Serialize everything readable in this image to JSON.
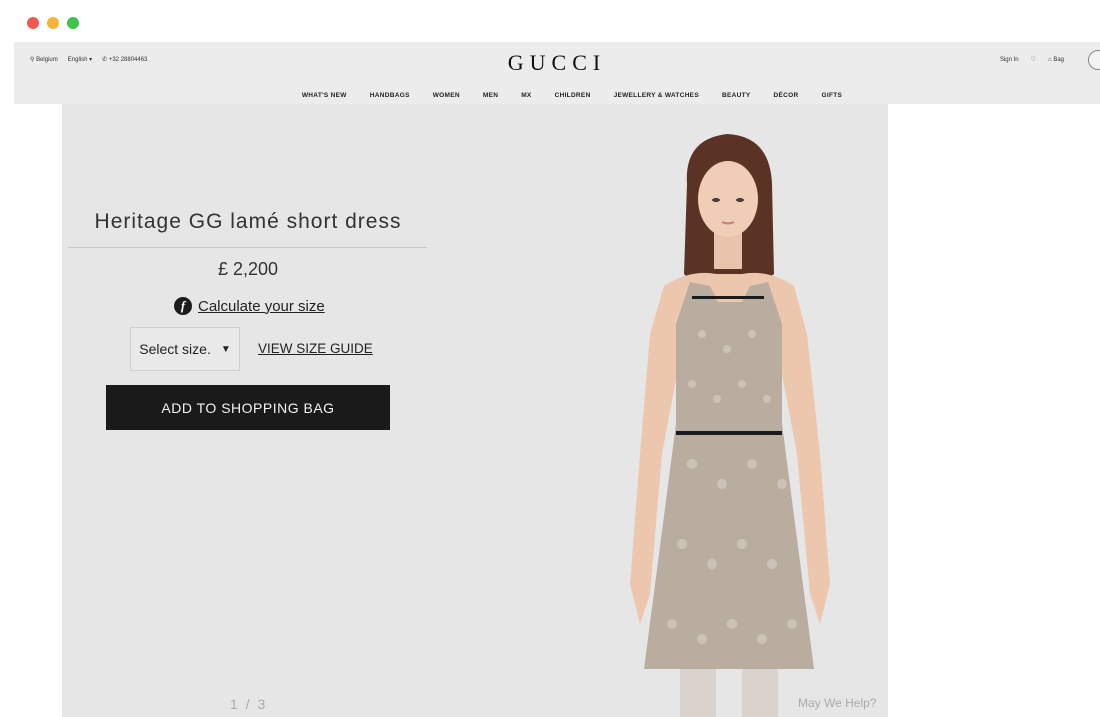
{
  "header": {
    "location": "Belgium",
    "language": "English",
    "phone": "+32 28804463",
    "logo": "GUCCI",
    "sign_in": "Sign In",
    "bag": "Bag"
  },
  "nav": [
    "WHAT'S NEW",
    "HANDBAGS",
    "WOMEN",
    "MEN",
    "MX",
    "CHILDREN",
    "JEWELLERY & WATCHES",
    "BEAUTY",
    "DÉCOR",
    "GIFTS"
  ],
  "product": {
    "title": "Heritage GG lamé short dress",
    "price": "£ 2,200",
    "calculate_size": "Calculate your size",
    "select_size": "Select size.",
    "size_guide": "VIEW SIZE GUIDE",
    "add_to_bag": "ADD TO SHOPPING BAG"
  },
  "gallery": {
    "pager": "1 / 3"
  },
  "help": "May We Help?",
  "colors": {
    "panel_bg": "#e6e6e6",
    "button_bg": "#1a1a1a",
    "dress": "#b9ada0"
  }
}
